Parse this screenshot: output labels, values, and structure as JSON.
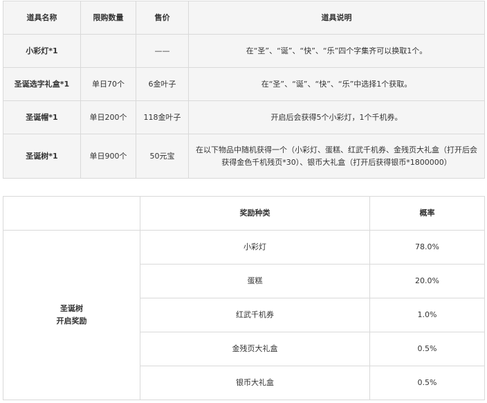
{
  "items_table": {
    "headers": [
      "道具名称",
      "限购数量",
      "售价",
      "道具说明"
    ],
    "rows": [
      {
        "name": "小彩灯*1",
        "limit": "",
        "price": "——",
        "description": "在“圣”、“诞”、“快”、“乐”四个字集齐可以换取1个。"
      },
      {
        "name": "圣诞选字礼盒*1",
        "limit": "单日70个",
        "price": "6金叶子",
        "description": "在“圣”、“诞”、“快”、“乐”中选择1个获取。"
      },
      {
        "name": "圣诞帽*1",
        "limit": "单日200个",
        "price": "118金叶子",
        "description": "开启后会获得5个小彩灯，1个千机券。"
      },
      {
        "name": "圣诞树*1",
        "limit": "单日900个",
        "price": "50元宝",
        "description": "在以下物品中随机获得一个（小彩灯、蛋糕、红武千机券、金残页大礼盒（打开后会获得金色千机残页*30）、银币大礼盒（打开后获得银币*1800000）"
      }
    ]
  },
  "reward_table": {
    "headers": [
      "",
      "奖励种类",
      "概率"
    ],
    "group_label_line1": "圣诞树",
    "group_label_line2": "开启奖励",
    "rows": [
      {
        "reward": "小彩灯",
        "probability": "78.0%"
      },
      {
        "reward": "蛋糕",
        "probability": "20.0%"
      },
      {
        "reward": "红武千机券",
        "probability": "1.0%"
      },
      {
        "reward": "金残页大礼盒",
        "probability": "0.5%"
      },
      {
        "reward": "银币大礼盒",
        "probability": "0.5%"
      }
    ]
  }
}
